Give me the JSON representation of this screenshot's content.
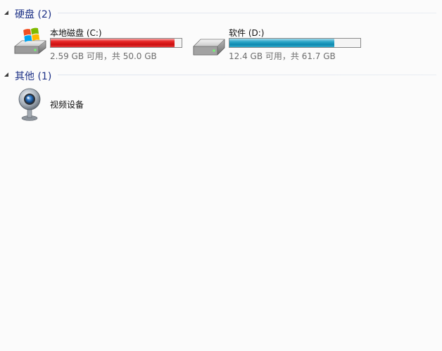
{
  "groups": [
    {
      "title": "硬盘 (2)"
    },
    {
      "title": "其他 (1)"
    }
  ],
  "drives": [
    {
      "name": "本地磁盘 (C:)",
      "free": "2.59 GB",
      "total": "50.0 GB",
      "used_fraction": 0.948,
      "color": "#cc0e0e",
      "meta": "2.59 GB 可用，共 50.0 GB",
      "icon": "windows-drive-icon"
    },
    {
      "name": "软件 (D:)",
      "free": "12.4 GB",
      "total": "61.7 GB",
      "used_fraction": 0.799,
      "color": "#0d89b0",
      "meta": "12.4 GB 可用，共 61.7 GB",
      "icon": "hard-drive-icon"
    }
  ],
  "others": [
    {
      "name": "视频设备",
      "icon": "webcam-icon"
    }
  ]
}
